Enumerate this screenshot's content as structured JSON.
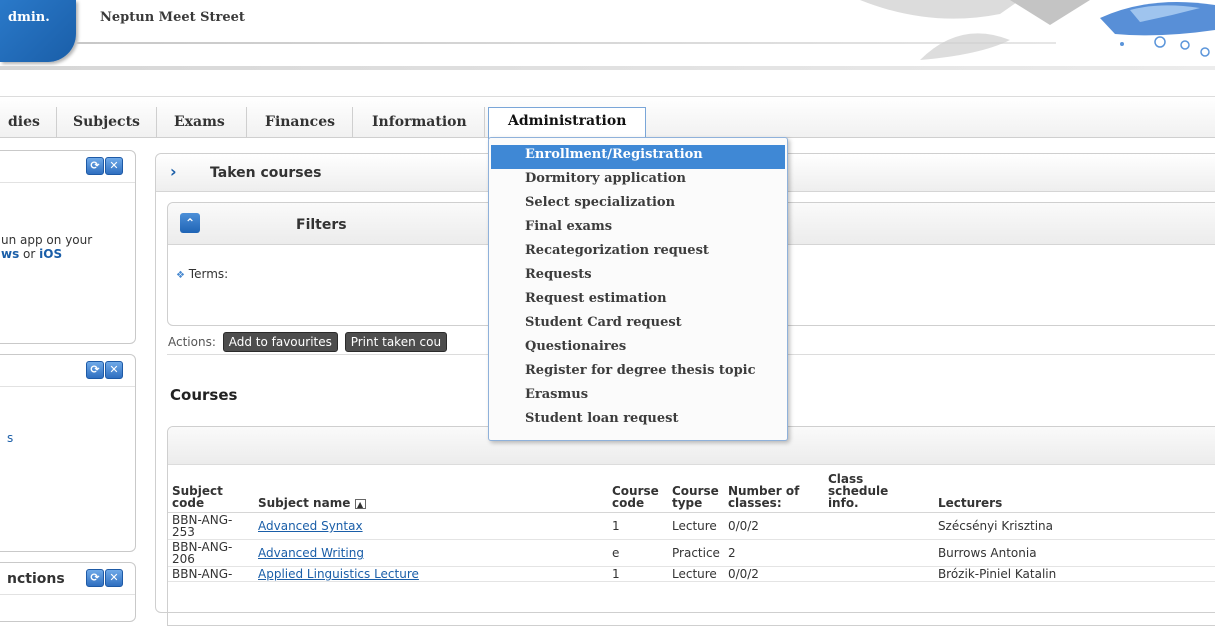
{
  "header": {
    "logo_text": "dmin.",
    "org_name": "Neptun Meet Street"
  },
  "menu": {
    "tabs": [
      {
        "label": "dies"
      },
      {
        "label": "Subjects"
      },
      {
        "label": "Exams"
      },
      {
        "label": "Finances"
      },
      {
        "label": "Information"
      }
    ],
    "active_tab": "Administration",
    "dropdown": [
      "Enrollment/Registration",
      "Dormitory application",
      "Select specialization",
      "Final exams",
      "Recategorization request",
      "Requests",
      "Request estimation",
      "Student Card request",
      "Questionaires",
      "Register for degree thesis topic",
      "Erasmus",
      "Student loan request"
    ]
  },
  "sidebar": {
    "box1": {
      "line1": "un app on your",
      "link1": "ws",
      "or": " or ",
      "link2": "iOS"
    },
    "box2": {
      "text": "s"
    },
    "box3": {
      "title": "nctions"
    }
  },
  "panel": {
    "title": "Taken courses",
    "filters": {
      "title": "Filters",
      "terms_label": "Terms:"
    },
    "actions": {
      "label": "Actions:",
      "buttons": [
        "Add to favourites",
        "Print taken cou"
      ]
    },
    "courses_title": "Courses",
    "table": {
      "headers": {
        "subject_code_1": "Subject",
        "subject_code_2": "code",
        "subject_name": "Subject name",
        "course_code_1": "Course",
        "course_code_2": "code",
        "course_type_1": "Course",
        "course_type_2": "type",
        "num_classes_1": "Number of",
        "num_classes_2": "classes:",
        "schedule_1": "Class",
        "schedule_2": "schedule",
        "schedule_3": "info.",
        "lecturers": "Lecturers"
      },
      "rows": [
        {
          "code1": "BBN-ANG-",
          "code2": "253",
          "name": "Advanced Syntax",
          "course_code": "1",
          "type": "Lecture",
          "classes": "0/0/2",
          "schedule": "",
          "lecturers": "Szécsényi Krisztina"
        },
        {
          "code1": "BBN-ANG-",
          "code2": "206",
          "name": "Advanced Writing",
          "course_code": "e",
          "type": "Practice",
          "classes": "2",
          "schedule": "",
          "lecturers": "Burrows Antonia"
        },
        {
          "code1": "BBN-ANG-",
          "code2": "",
          "name": "Applied Linguistics Lecture",
          "course_code": "1",
          "type": "Lecture",
          "classes": "0/0/2",
          "schedule": "",
          "lecturers": "Brózik-Piniel Katalin"
        }
      ]
    }
  }
}
